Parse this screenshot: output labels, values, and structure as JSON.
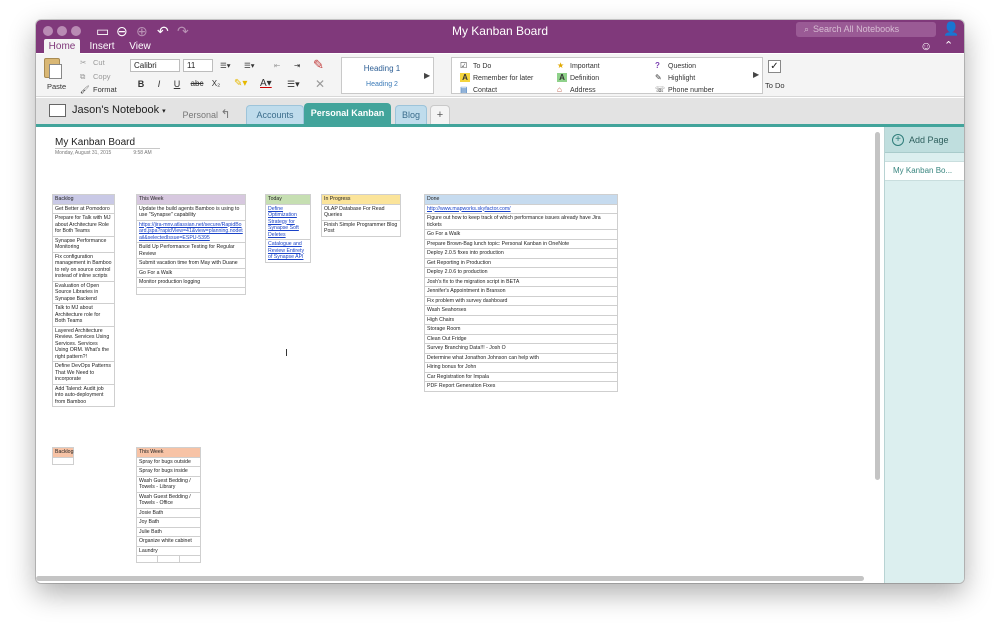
{
  "window": {
    "title": "My Kanban Board",
    "search_placeholder": "Search All Notebooks"
  },
  "ribbon_tabs": [
    "Home",
    "Insert",
    "View"
  ],
  "clipboard": {
    "paste": "Paste",
    "cut": "Cut",
    "copy": "Copy",
    "format": "Format"
  },
  "font": {
    "family": "Calibri",
    "size": "11"
  },
  "format_buttons": {
    "bold": "B",
    "italic": "I",
    "underline": "U",
    "strike": "abc",
    "subscript": "X₂"
  },
  "styles": {
    "heading1": "Heading 1",
    "heading2": "Heading 2"
  },
  "tags": [
    {
      "icon": "☑",
      "label": "To Do"
    },
    {
      "icon": "★",
      "label": "Important"
    },
    {
      "icon": "?",
      "label": "Question"
    },
    {
      "icon": "A",
      "label": "Remember for later"
    },
    {
      "icon": "A",
      "label": "Definition"
    },
    {
      "icon": "✎",
      "label": "Highlight"
    },
    {
      "icon": "▤",
      "label": "Contact"
    },
    {
      "icon": "⌂",
      "label": "Address"
    },
    {
      "icon": "☏",
      "label": "Phone number"
    }
  ],
  "todo_button": "To Do",
  "notebook": {
    "name": "Jason's Notebook"
  },
  "section_tabs": [
    "Personal",
    "Accounts",
    "Personal Kanban",
    "Blog",
    "+"
  ],
  "page": {
    "title": "My Kanban Board",
    "date": "Monday, August 31, 2015",
    "time": "9:58 AM"
  },
  "sidebar": {
    "add_page": "Add Page",
    "pages": [
      "My Kanban Bo..."
    ]
  },
  "boards": {
    "backlog": {
      "header": "Backlog",
      "items": [
        "Get Better at Pomodoro",
        "Prepare for Talk with MJ about Architecture Role for Both Teams",
        "Synapse Performance Monitoring",
        "Fix configuration management in Bamboo to rely on source control instead of inline scripts",
        "Evaluation of Open Source Libraries in Synapse Backend",
        "Talk to MJ about Architecture role for Both Teams",
        "Layered Architecture Review. Services Using Services. Services Using ORM. What's the right pattern?!",
        "Define DevOps Patterns That We Need to incorporate",
        "Add Talend: Audit job into auto-deployment from Bamboo"
      ]
    },
    "this_week": {
      "header": "This Week",
      "items": [
        "Update the build agents Bamboo is using to use \"Synapse\" capability",
        "https://jira-mnv.atlassian.net/secure/RapidBoard.jspa?rapidView=41&view=planning.nodetail&selectedIssue=ESPU-5395",
        "Build Up Performance Testing for Regular Review",
        "Submit vacation time from May with Duane",
        "Go For a Walk",
        "Monitor production logging"
      ]
    },
    "today": {
      "header": "Today",
      "items": [
        "Define Optimization Strategy for Synapse Soft Deletes",
        "Catalogue and Review Entirety of Synapse API"
      ]
    },
    "in_progress": {
      "header": "In Progress",
      "items": [
        "OLAP Database For Read Queries",
        "Finish Simple Programmer Blog Post"
      ]
    },
    "done": {
      "header": "Done",
      "items": [
        "http://www.mapworks.skyfactor.com/",
        "Figure out how to keep track of which performance issues already have Jira tickets",
        "Go For a Walk",
        "Prepare Brown-Bag lunch topic: Personal Kanban in OneNote",
        "Deploy 2.0.5 fixes into production",
        "Get Reporting in Production",
        "Deploy 2.0.6 to production",
        "Josh's fix to the migration script in BETA",
        "Jennifer's Appointment in Branson",
        "Fix problem with survey dashboard",
        "Wash Seahorses",
        "High Chairs",
        "Storage Room",
        "Clean Out Fridge",
        "Survey Branching Data!!! - Josh O",
        "Determine what Jonathon Johnson can help with",
        "Hiring bonus for John",
        "Car Registration for Impala",
        "PDF Report Generation Fixes"
      ]
    },
    "backlog2": {
      "header": "Backlog"
    },
    "this_week2": {
      "header": "This Week",
      "items": [
        "Spray for bugs outside",
        "Spray for bugs inside",
        "Wash Guest Bedding / Towels - Library",
        "Wash Guest Bedding / Towels - Office",
        "Josie Bath",
        "Joy Bath",
        "Julie Bath",
        "Organize white cabinet",
        "Laundry"
      ]
    }
  },
  "colors": {
    "titlebar": "#80397b",
    "accent_teal": "#42a49b",
    "backlog_header": "#c9c9e6",
    "this_week_header": "#d7c8df",
    "today_header": "#c6dfb2",
    "in_progress_header": "#fbe49a",
    "done_header": "#c6dbef",
    "backlog2_header": "#f7c3a6",
    "this_week2_header": "#f7c3a6"
  }
}
